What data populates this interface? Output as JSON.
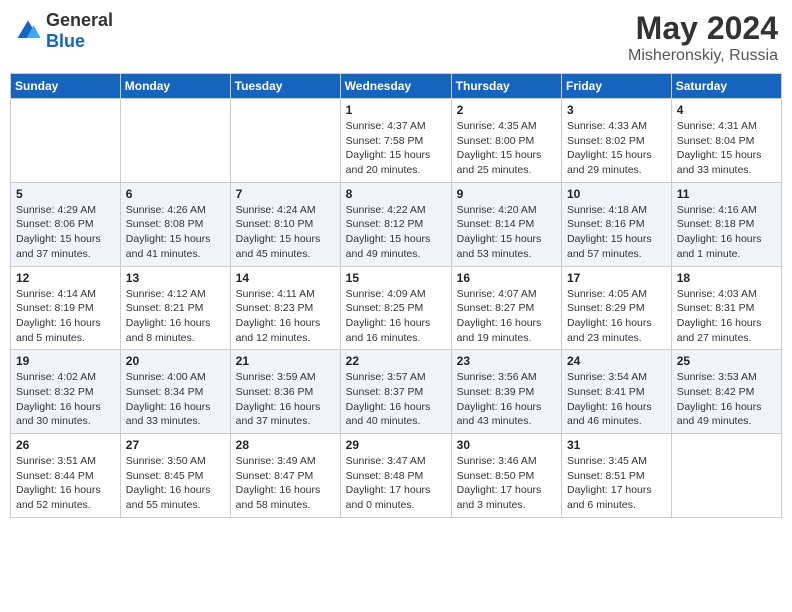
{
  "header": {
    "logo_general": "General",
    "logo_blue": "Blue",
    "month": "May 2024",
    "location": "Misheronskiy, Russia"
  },
  "weekdays": [
    "Sunday",
    "Monday",
    "Tuesday",
    "Wednesday",
    "Thursday",
    "Friday",
    "Saturday"
  ],
  "weeks": [
    [
      {
        "day": "",
        "info": ""
      },
      {
        "day": "",
        "info": ""
      },
      {
        "day": "",
        "info": ""
      },
      {
        "day": "1",
        "info": "Sunrise: 4:37 AM\nSunset: 7:58 PM\nDaylight: 15 hours\nand 20 minutes."
      },
      {
        "day": "2",
        "info": "Sunrise: 4:35 AM\nSunset: 8:00 PM\nDaylight: 15 hours\nand 25 minutes."
      },
      {
        "day": "3",
        "info": "Sunrise: 4:33 AM\nSunset: 8:02 PM\nDaylight: 15 hours\nand 29 minutes."
      },
      {
        "day": "4",
        "info": "Sunrise: 4:31 AM\nSunset: 8:04 PM\nDaylight: 15 hours\nand 33 minutes."
      }
    ],
    [
      {
        "day": "5",
        "info": "Sunrise: 4:29 AM\nSunset: 8:06 PM\nDaylight: 15 hours\nand 37 minutes."
      },
      {
        "day": "6",
        "info": "Sunrise: 4:26 AM\nSunset: 8:08 PM\nDaylight: 15 hours\nand 41 minutes."
      },
      {
        "day": "7",
        "info": "Sunrise: 4:24 AM\nSunset: 8:10 PM\nDaylight: 15 hours\nand 45 minutes."
      },
      {
        "day": "8",
        "info": "Sunrise: 4:22 AM\nSunset: 8:12 PM\nDaylight: 15 hours\nand 49 minutes."
      },
      {
        "day": "9",
        "info": "Sunrise: 4:20 AM\nSunset: 8:14 PM\nDaylight: 15 hours\nand 53 minutes."
      },
      {
        "day": "10",
        "info": "Sunrise: 4:18 AM\nSunset: 8:16 PM\nDaylight: 15 hours\nand 57 minutes."
      },
      {
        "day": "11",
        "info": "Sunrise: 4:16 AM\nSunset: 8:18 PM\nDaylight: 16 hours\nand 1 minute."
      }
    ],
    [
      {
        "day": "12",
        "info": "Sunrise: 4:14 AM\nSunset: 8:19 PM\nDaylight: 16 hours\nand 5 minutes."
      },
      {
        "day": "13",
        "info": "Sunrise: 4:12 AM\nSunset: 8:21 PM\nDaylight: 16 hours\nand 8 minutes."
      },
      {
        "day": "14",
        "info": "Sunrise: 4:11 AM\nSunset: 8:23 PM\nDaylight: 16 hours\nand 12 minutes."
      },
      {
        "day": "15",
        "info": "Sunrise: 4:09 AM\nSunset: 8:25 PM\nDaylight: 16 hours\nand 16 minutes."
      },
      {
        "day": "16",
        "info": "Sunrise: 4:07 AM\nSunset: 8:27 PM\nDaylight: 16 hours\nand 19 minutes."
      },
      {
        "day": "17",
        "info": "Sunrise: 4:05 AM\nSunset: 8:29 PM\nDaylight: 16 hours\nand 23 minutes."
      },
      {
        "day": "18",
        "info": "Sunrise: 4:03 AM\nSunset: 8:31 PM\nDaylight: 16 hours\nand 27 minutes."
      }
    ],
    [
      {
        "day": "19",
        "info": "Sunrise: 4:02 AM\nSunset: 8:32 PM\nDaylight: 16 hours\nand 30 minutes."
      },
      {
        "day": "20",
        "info": "Sunrise: 4:00 AM\nSunset: 8:34 PM\nDaylight: 16 hours\nand 33 minutes."
      },
      {
        "day": "21",
        "info": "Sunrise: 3:59 AM\nSunset: 8:36 PM\nDaylight: 16 hours\nand 37 minutes."
      },
      {
        "day": "22",
        "info": "Sunrise: 3:57 AM\nSunset: 8:37 PM\nDaylight: 16 hours\nand 40 minutes."
      },
      {
        "day": "23",
        "info": "Sunrise: 3:56 AM\nSunset: 8:39 PM\nDaylight: 16 hours\nand 43 minutes."
      },
      {
        "day": "24",
        "info": "Sunrise: 3:54 AM\nSunset: 8:41 PM\nDaylight: 16 hours\nand 46 minutes."
      },
      {
        "day": "25",
        "info": "Sunrise: 3:53 AM\nSunset: 8:42 PM\nDaylight: 16 hours\nand 49 minutes."
      }
    ],
    [
      {
        "day": "26",
        "info": "Sunrise: 3:51 AM\nSunset: 8:44 PM\nDaylight: 16 hours\nand 52 minutes."
      },
      {
        "day": "27",
        "info": "Sunrise: 3:50 AM\nSunset: 8:45 PM\nDaylight: 16 hours\nand 55 minutes."
      },
      {
        "day": "28",
        "info": "Sunrise: 3:49 AM\nSunset: 8:47 PM\nDaylight: 16 hours\nand 58 minutes."
      },
      {
        "day": "29",
        "info": "Sunrise: 3:47 AM\nSunset: 8:48 PM\nDaylight: 17 hours\nand 0 minutes."
      },
      {
        "day": "30",
        "info": "Sunrise: 3:46 AM\nSunset: 8:50 PM\nDaylight: 17 hours\nand 3 minutes."
      },
      {
        "day": "31",
        "info": "Sunrise: 3:45 AM\nSunset: 8:51 PM\nDaylight: 17 hours\nand 6 minutes."
      },
      {
        "day": "",
        "info": ""
      }
    ]
  ]
}
